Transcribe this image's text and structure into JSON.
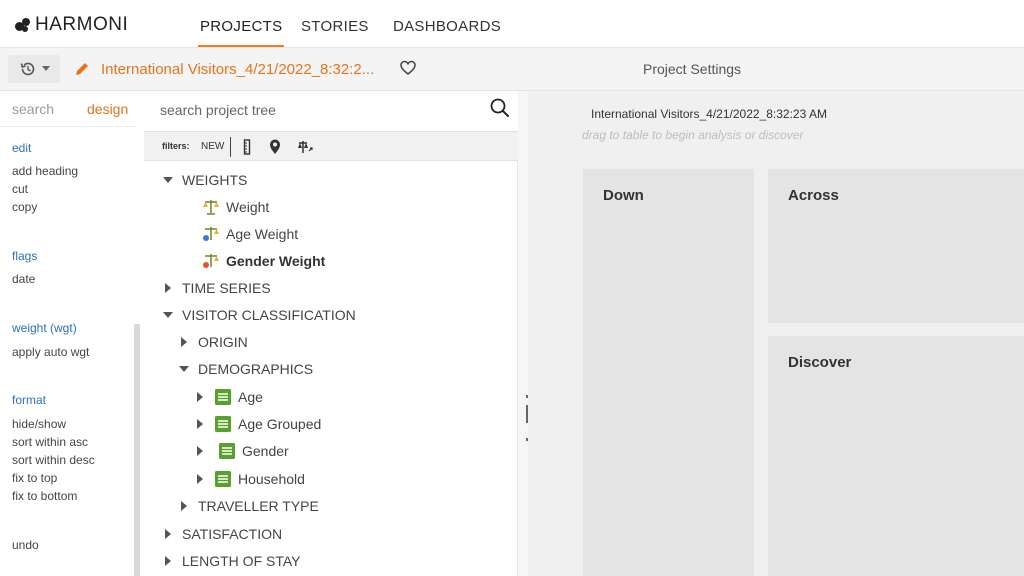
{
  "app": {
    "logo_text": "HARMONI"
  },
  "nav": {
    "tabs": [
      {
        "label": "PROJECTS"
      },
      {
        "label": "STORIES"
      },
      {
        "label": "DASHBOARDS"
      }
    ]
  },
  "toolbar": {
    "project_title": "International Visitors_4/21/2022_8:32:2...",
    "settings_label": "Project Settings"
  },
  "left_panel": {
    "tabs": [
      {
        "label": "search"
      },
      {
        "label": "design"
      }
    ],
    "sections": [
      {
        "title": "edit",
        "items": [
          "add heading",
          "cut",
          "copy"
        ]
      },
      {
        "title": "flags",
        "items": [
          "date"
        ]
      },
      {
        "title": "weight (wgt)",
        "items": [
          "apply auto wgt"
        ]
      },
      {
        "title": "format",
        "items": [
          "hide/show",
          "sort within asc",
          "sort within desc",
          "fix to top",
          "fix to bottom"
        ]
      }
    ],
    "undo_label": "undo"
  },
  "tree_search": {
    "placeholder": "search project tree"
  },
  "filters": {
    "label": "filters:",
    "new_label": "NEW"
  },
  "tree": {
    "weights": "WEIGHTS",
    "weight": "Weight",
    "age_weight": "Age Weight",
    "gender_weight": "Gender Weight",
    "time_series": "TIME SERIES",
    "visitor_classification": "VISITOR CLASSIFICATION",
    "origin": "ORIGIN",
    "demographics": "DEMOGRAPHICS",
    "age": "Age",
    "age_grouped": "Age Grouped",
    "gender": "Gender",
    "household": "Household",
    "traveller_type": "TRAVELLER TYPE",
    "satisfaction": "SATISFACTION",
    "length_of_stay": "LENGTH OF STAY"
  },
  "analysis": {
    "title": "International Visitors_4/21/2022_8:32:23 AM",
    "hint": "drag to table to begin analysis or discover",
    "down_label": "Down",
    "across_label": "Across",
    "discover_label": "Discover"
  },
  "colors": {
    "accent": "#f07c1e",
    "link": "#2e6fbd",
    "selected_bg": "#f4e2d0",
    "variable_icon": "#5aa02c"
  }
}
